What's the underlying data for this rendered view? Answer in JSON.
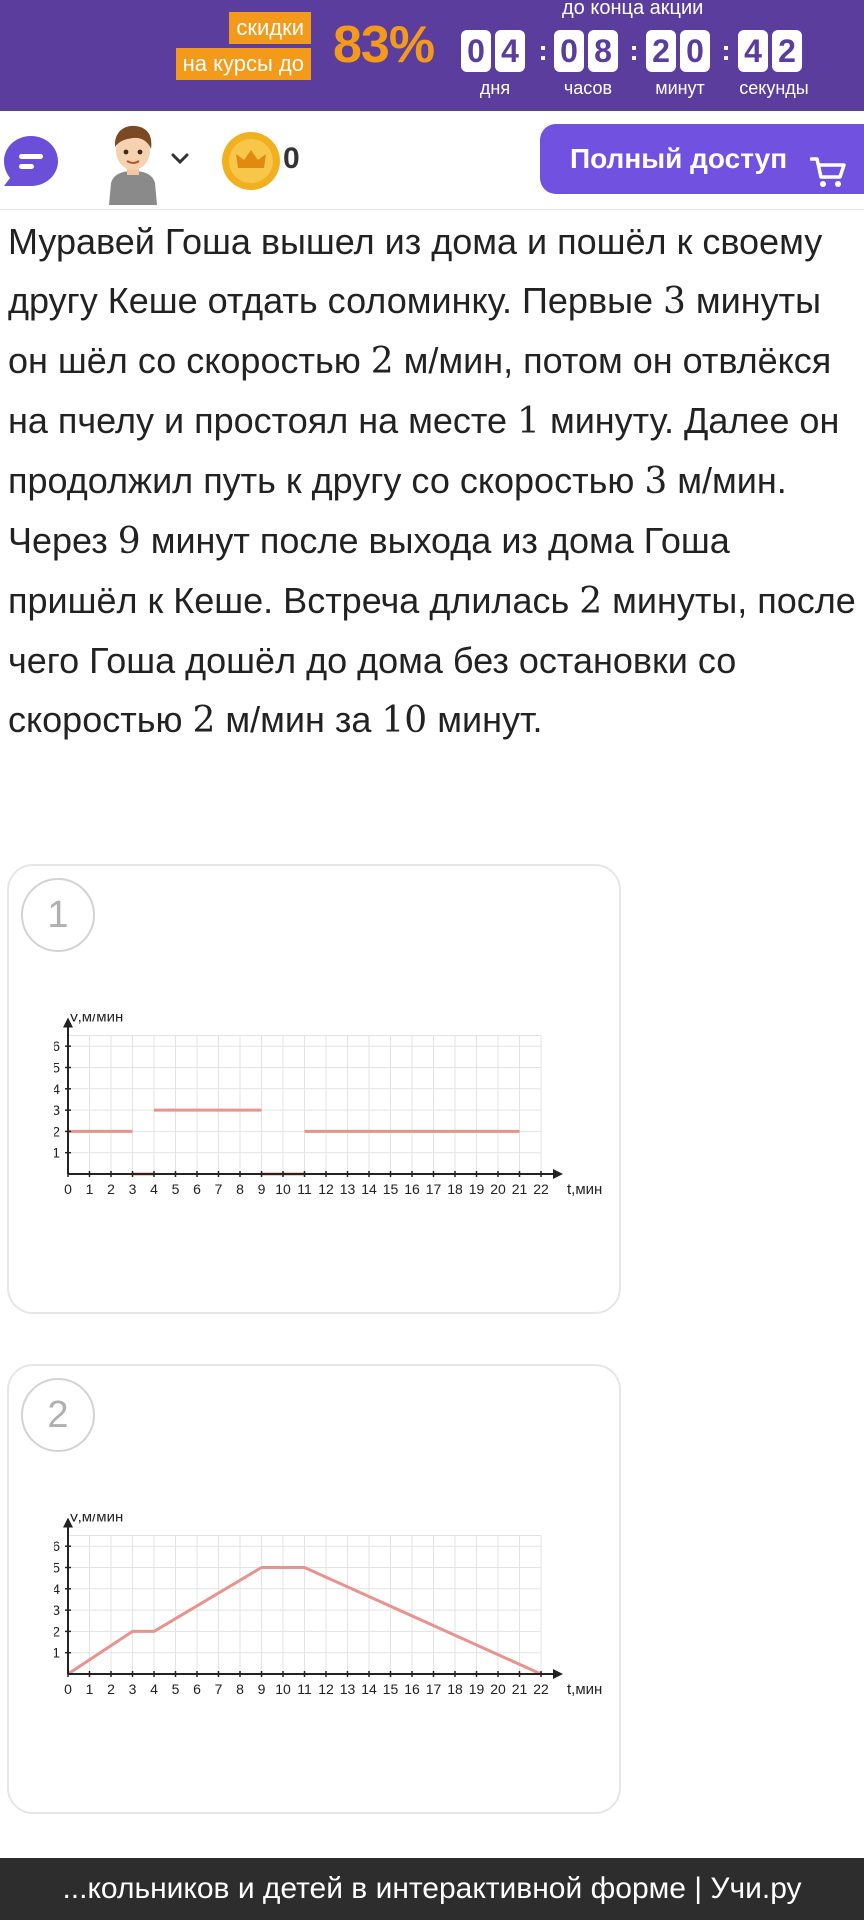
{
  "promo": {
    "tag_line1": "скидки",
    "tag_line2": "на курсы до",
    "percent": "83%",
    "until_label": "до конца акции",
    "countdown": {
      "days": [
        "0",
        "4"
      ],
      "hours": [
        "0",
        "8"
      ],
      "minutes": [
        "2",
        "0"
      ],
      "seconds": [
        "4",
        "2"
      ]
    },
    "units": {
      "days": "дня",
      "hours": "часов",
      "minutes": "минут",
      "seconds": "секунды"
    },
    "colors": {
      "background": "#5b3d9e",
      "accent": "#f49a1a"
    }
  },
  "header": {
    "menu_icon": "chat-menu-icon",
    "avatar_icon": "boy-avatar-icon",
    "chevron_icon": "chevron-down-icon",
    "coin_icon": "crown-coin-icon",
    "coin_count": "0",
    "full_access_label": "Полный доступ",
    "cart_icon": "cart-icon",
    "accent": "#7152e0"
  },
  "problem": {
    "text_parts": [
      "Муравей Гоша вышел из дома и пошёл к своему другу Кеше отдать соломинку. Первые ",
      "3",
      " минуты он шёл со скоростью ",
      "2",
      " м/мин, потом он отвлёкся на пчелу и простоял на месте ",
      "1",
      " минуту. Далее он продолжил путь к другу со скоростью ",
      "3",
      " м/мин. Через ",
      "9",
      " минут после выхода из дома Гоша пришёл к Кеше. Встреча длилась ",
      "2",
      " минуты, после чего Гоша дошёл до дома без остановки со скоростью ",
      "2",
      " м/мин за ",
      "10",
      " минут."
    ]
  },
  "options": [
    {
      "number": "1"
    },
    {
      "number": "2"
    }
  ],
  "chart_data": [
    {
      "type": "line",
      "xlabel": "t,мин",
      "ylabel": "V,м/мин",
      "xlim": [
        0,
        22
      ],
      "ylim": [
        0,
        6
      ],
      "x_ticks": [
        0,
        1,
        2,
        3,
        4,
        5,
        6,
        7,
        8,
        9,
        10,
        11,
        12,
        13,
        14,
        15,
        16,
        17,
        18,
        19,
        20,
        21,
        22
      ],
      "y_ticks": [
        1,
        2,
        3,
        4,
        5,
        6
      ],
      "grid": true,
      "series": [
        {
          "segments": [
            {
              "x": [
                0,
                3
              ],
              "y": [
                2,
                2
              ]
            },
            {
              "x": [
                3,
                4
              ],
              "y": [
                0,
                0
              ]
            },
            {
              "x": [
                4,
                9
              ],
              "y": [
                3,
                3
              ]
            },
            {
              "x": [
                9,
                11
              ],
              "y": [
                0,
                0
              ]
            },
            {
              "x": [
                11,
                21
              ],
              "y": [
                2,
                2
              ]
            }
          ]
        }
      ],
      "line_color": "#e8938d"
    },
    {
      "type": "line",
      "xlabel": "t,мин",
      "ylabel": "V,м/мин",
      "xlim": [
        0,
        22
      ],
      "ylim": [
        0,
        6
      ],
      "x_ticks": [
        0,
        1,
        2,
        3,
        4,
        5,
        6,
        7,
        8,
        9,
        10,
        11,
        12,
        13,
        14,
        15,
        16,
        17,
        18,
        19,
        20,
        21,
        22
      ],
      "y_ticks": [
        1,
        2,
        3,
        4,
        5,
        6
      ],
      "grid": true,
      "series": [
        {
          "segments": [
            {
              "x": [
                0,
                3,
                4,
                9,
                11,
                22
              ],
              "y": [
                0,
                2,
                2,
                5,
                5,
                0
              ]
            }
          ]
        }
      ],
      "line_color": "#e8938d"
    }
  ],
  "footer": {
    "text": "...кольников и детей в интерактивной форме | Учи.ру"
  }
}
